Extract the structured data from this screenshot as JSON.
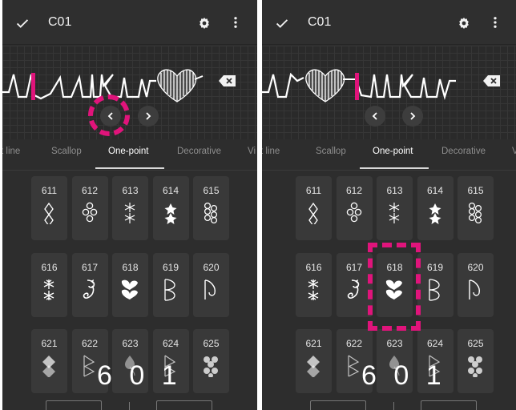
{
  "app": {
    "title": "C01"
  },
  "icons": {
    "confirm": "check-icon",
    "settings": "gear-icon",
    "more": "more-vert-icon",
    "delete": "backspace-icon",
    "prev": "chevron-left-icon",
    "next": "chevron-right-icon"
  },
  "tabs": [
    "t line",
    "Scallop",
    "One-point",
    "Decorative",
    "Vi"
  ],
  "active_tab": "One-point",
  "patterns": [
    [
      {
        "num": "611",
        "icon": "flower-chain-icon"
      },
      {
        "num": "612",
        "icon": "circle-chain-icon"
      },
      {
        "num": "613",
        "icon": "star-chain-icon"
      },
      {
        "num": "614",
        "icon": "star-pair-icon"
      },
      {
        "num": "615",
        "icon": "bubble-cluster-icon"
      }
    ],
    [
      {
        "num": "616",
        "icon": "snowflake-icon"
      },
      {
        "num": "617",
        "icon": "rose-icon"
      },
      {
        "num": "618",
        "icon": "double-heart-icon"
      },
      {
        "num": "619",
        "icon": "heart-outline-icon"
      },
      {
        "num": "620",
        "icon": "leaf-icon"
      }
    ],
    [
      {
        "num": "621",
        "icon": "diamond-icon"
      },
      {
        "num": "622",
        "icon": "diamond-outline-icon"
      },
      {
        "num": "623",
        "icon": "drop-icon"
      },
      {
        "num": "624",
        "icon": "diamond-outline-icon"
      },
      {
        "num": "625",
        "icon": "club-icon"
      }
    ]
  ],
  "counter": "6 0 1",
  "colors": {
    "background": "#2d2d2d",
    "cell": "#393939",
    "highlight": "#e0147b",
    "cursor": "#e0147b"
  }
}
